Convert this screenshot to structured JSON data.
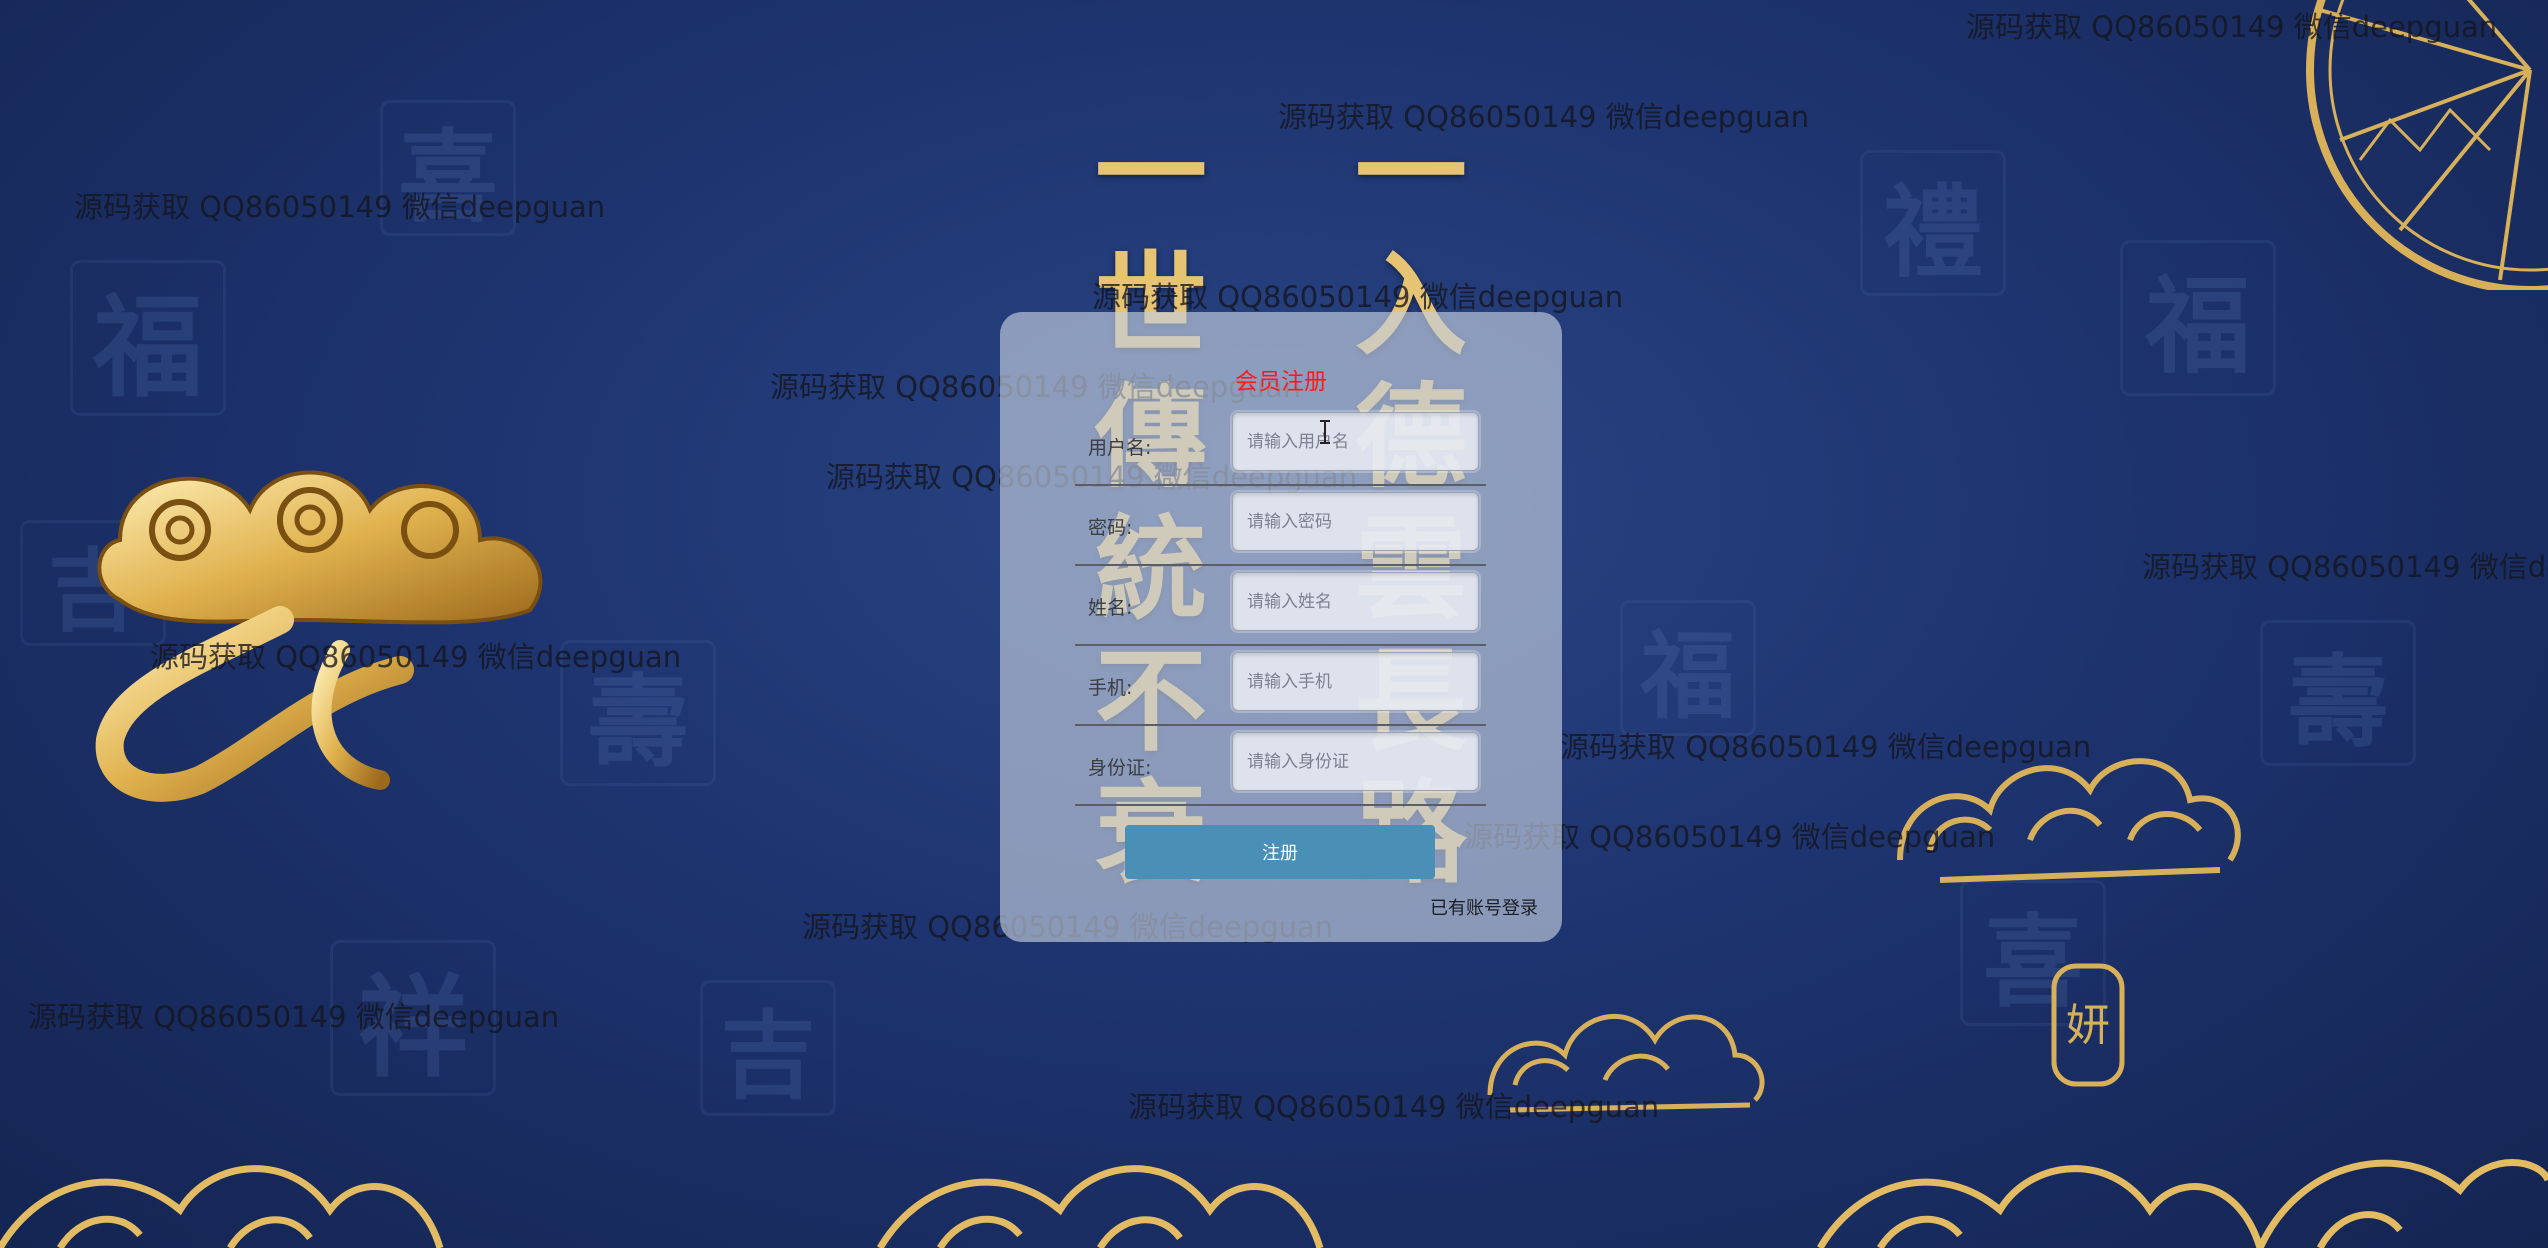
{
  "panel": {
    "title": "会员注册",
    "fields": [
      {
        "label": "用户名:",
        "placeholder": "请输入用户名"
      },
      {
        "label": "密码:",
        "placeholder": "请输入密码"
      },
      {
        "label": "姓名:",
        "placeholder": "请输入姓名"
      },
      {
        "label": "手机:",
        "placeholder": "请输入手机"
      },
      {
        "label": "身份证:",
        "placeholder": "请输入身份证"
      }
    ],
    "submit_label": "注册",
    "login_link": "已有账号登录"
  },
  "watermark_text": "源码获取 QQ86050149 微信deepguan",
  "background": {
    "calligraphy_left": [
      "一",
      "世",
      "傳",
      "統",
      "不",
      "衰"
    ],
    "calligraphy_right": [
      "一",
      "入",
      "德",
      "雲",
      "長",
      "路"
    ],
    "seal": "妍"
  },
  "colors": {
    "background": "#1e3470",
    "gold": "#e6c474",
    "title_red": "#ff1a1a",
    "button": "#4a8fb6"
  }
}
